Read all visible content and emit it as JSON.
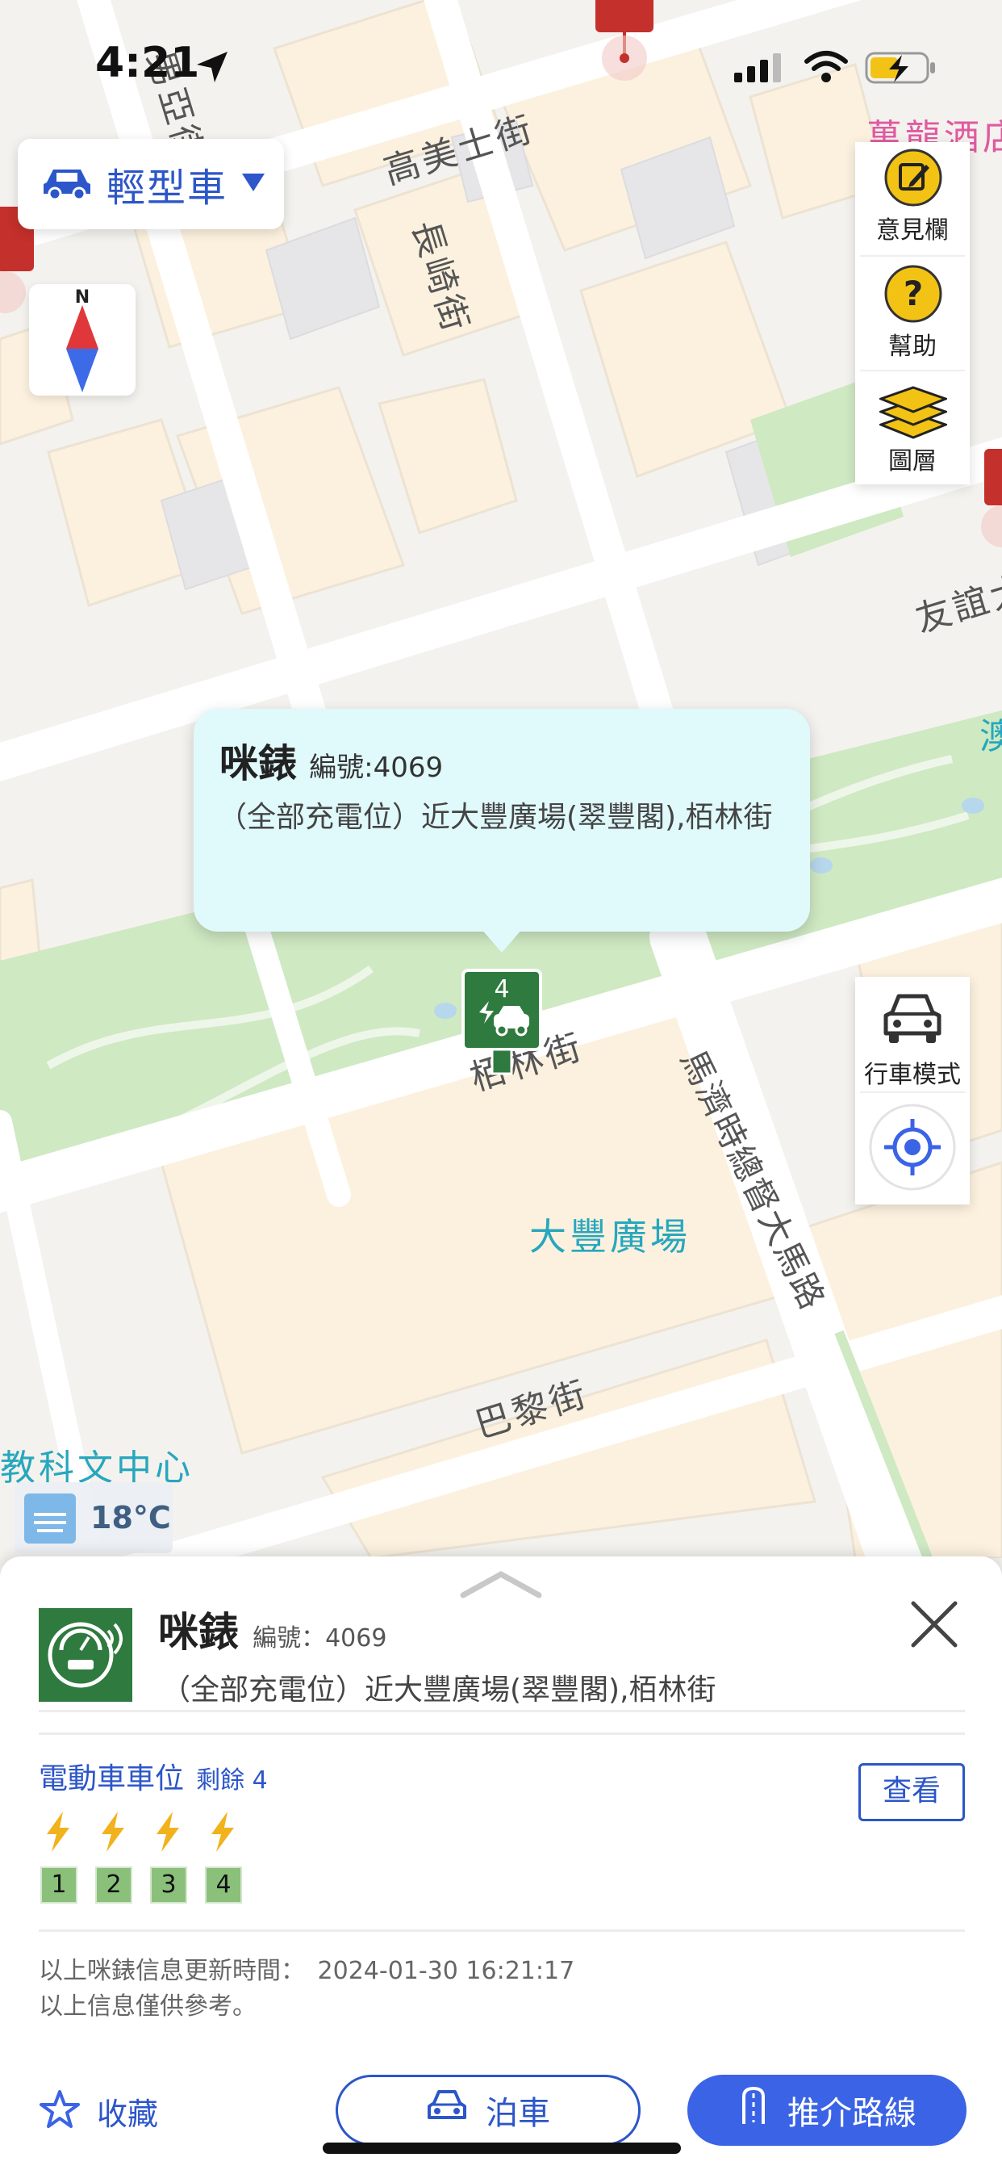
{
  "status_bar": {
    "time": "4:21"
  },
  "vehicle_selector": {
    "label": "輕型車",
    "dropdown_icon": "chevron-down-icon"
  },
  "compass": {
    "north_label": "N"
  },
  "map": {
    "labels": {
      "hotel_partial": "萬龍酒店",
      "street_1": "高美士街",
      "street_2": "長崎街",
      "street_3": "友誼大",
      "street_4": "栢林街",
      "street_5": "馬濟時總督大馬路",
      "square": "大豐廣場",
      "street_6": "巴黎街",
      "center_partial": "教科文中心",
      "street_7": "男亞街",
      "edge_partial": "澳"
    },
    "marker": {
      "count": "4"
    }
  },
  "tools": {
    "feedback": "意見欄",
    "help": "幫助",
    "layers": "圖層",
    "drive_mode": "行車模式"
  },
  "callout": {
    "name": "咪錶",
    "code": "編號:4069",
    "address": "（全部充電位）近大豐廣場(翠豐閣),栢林街"
  },
  "weather": {
    "temperature": "18°C"
  },
  "sheet": {
    "name": "咪錶",
    "code": "編號：4069",
    "address": "（全部充電位）近大豐廣場(翠豐閣),栢林街",
    "ev_section_title": "電動車車位",
    "remaining": "剩餘 4",
    "view_button": "查看",
    "spots": [
      "1",
      "2",
      "3",
      "4"
    ],
    "update_label": "以上咪錶信息更新時間：",
    "update_time": "2024-01-30 16:21:17",
    "disclaimer": "以上信息僅供參考。",
    "favorite": "收藏",
    "park_button": "泊車",
    "route_button": "推介路線"
  },
  "colors": {
    "accent": "#2c56c9",
    "primary_button": "#3b63e6",
    "callout_bg": "#e0f9fb",
    "meter_green": "#2f7a3e",
    "spot_green": "#8ac07a",
    "lightning": "#f2b21c"
  }
}
